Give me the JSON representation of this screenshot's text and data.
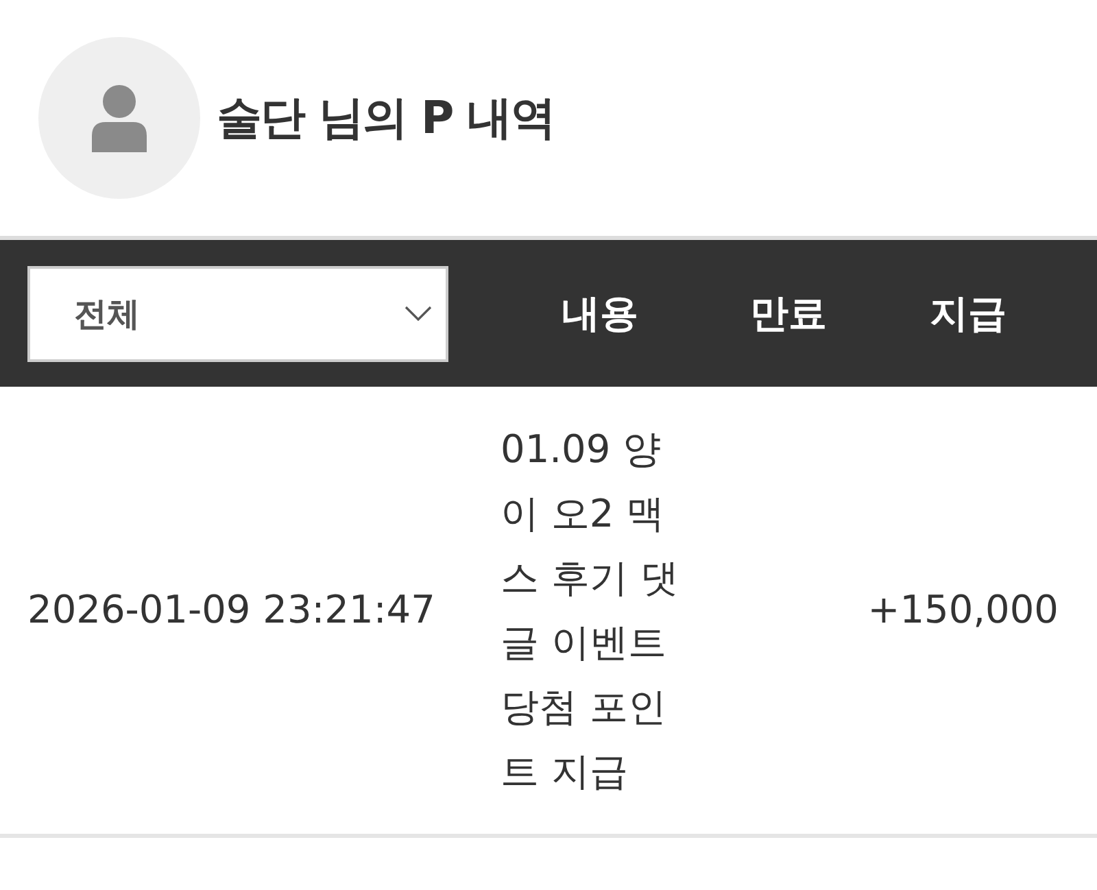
{
  "profile": {
    "title": "술단 님의 P 내역"
  },
  "filter": {
    "value": "전체"
  },
  "columns": [
    "내용",
    "만료",
    "지급"
  ],
  "rows": [
    {
      "date": "2026-01-09 23:21:47",
      "content": "01.09 양이 오2 맥스 후기 댓글 이벤트 당첨 포인트 지급",
      "amount": "+150,000"
    }
  ]
}
